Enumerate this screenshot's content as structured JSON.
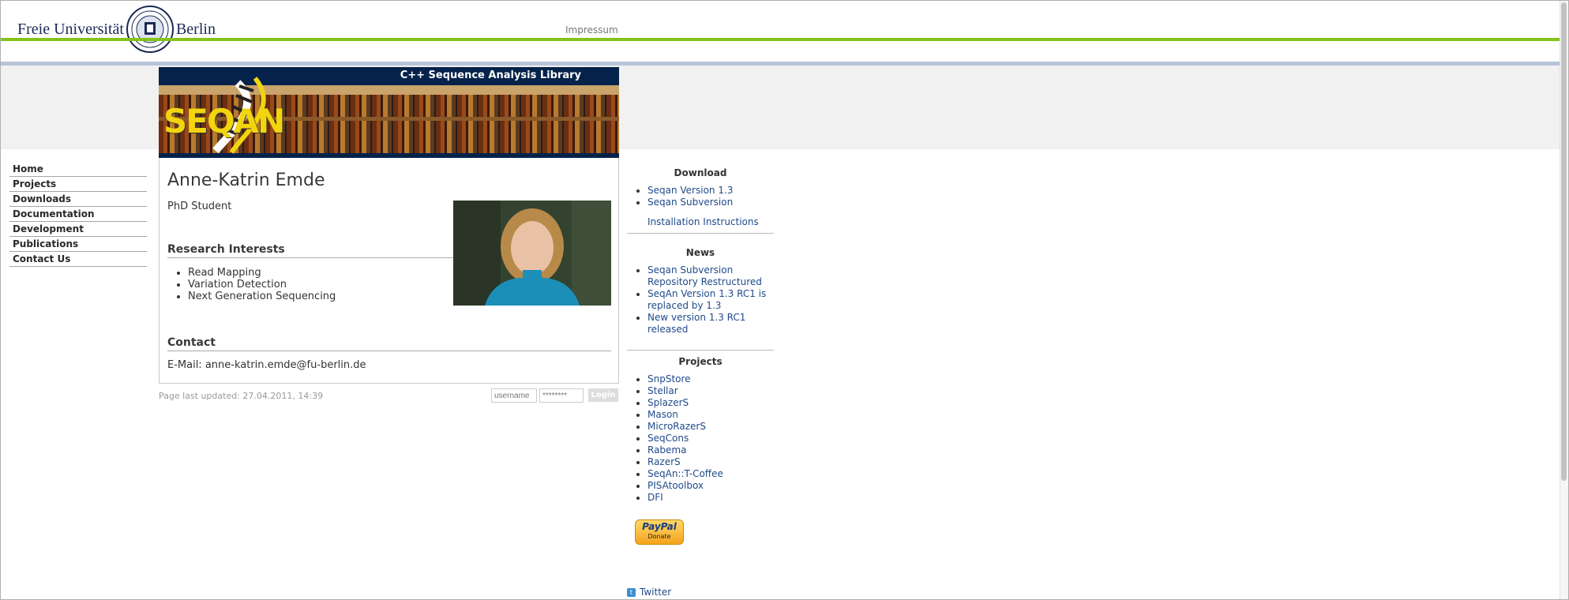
{
  "header": {
    "fu_left": "Freie Universität",
    "fu_right": "Berlin",
    "impressum": "Impressum"
  },
  "banner": {
    "title": "C++ Sequence Analysis Library",
    "logo_text": "SEQAN"
  },
  "nav": {
    "items": [
      {
        "label": "Home"
      },
      {
        "label": "Projects"
      },
      {
        "label": "Downloads"
      },
      {
        "label": "Documentation"
      },
      {
        "label": "Development"
      },
      {
        "label": "Publications"
      },
      {
        "label": "Contact Us"
      }
    ]
  },
  "profile": {
    "name": "Anne-Katrin Emde",
    "role": "PhD Student",
    "research_heading": "Research Interests",
    "interests": [
      "Read Mapping",
      "Variation Detection",
      "Next Generation Sequencing"
    ],
    "contact_heading": "Contact",
    "email": "E-Mail: anne-katrin.emde@fu-berlin.de"
  },
  "footer": {
    "updated": "Page last updated: 27.04.2011, 14:39",
    "username_placeholder": "username",
    "password_placeholder": "********",
    "login_label": "Login"
  },
  "sidebar": {
    "download_heading": "Download",
    "downloads": [
      "Seqan Version 1.3",
      "Seqan Subversion"
    ],
    "install": "Installation Instructions",
    "news_heading": "News",
    "news": [
      "Seqan Subversion Repository Restructured",
      "SeqAn Version 1.3 RC1 is replaced by 1.3",
      "New version 1.3 RC1 released"
    ],
    "projects_heading": "Projects",
    "projects": [
      "SnpStore",
      "Stellar",
      "SplazerS",
      "Mason",
      "MicroRazerS",
      "SeqCons",
      "Rabema",
      "RazerS",
      "SeqAn::T-Coffee",
      "PISAtoolbox",
      "DFI"
    ],
    "paypal_brand": "PayPal",
    "paypal_action": "Donate",
    "twitter": "Twitter"
  },
  "colors": {
    "accent_green": "#84c31a",
    "accent_blue": "#b8c4d8",
    "banner_navy": "#05224a",
    "link": "#1f4a8a",
    "logo_yellow": "#f2d40f"
  }
}
